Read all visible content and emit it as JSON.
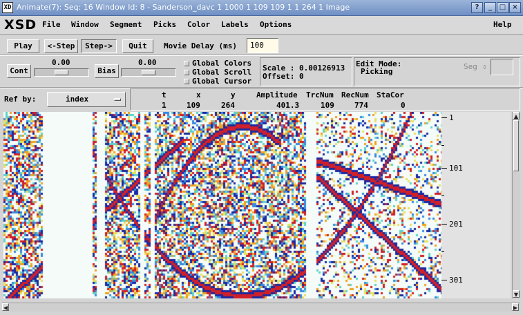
{
  "window": {
    "title": "Animate(7): Seq: 16 Window Id: 8 - Sanderson_davc 1 1000 1 109 109 1 1 264 1 Image",
    "icon": "xsd-icon"
  },
  "menubar": {
    "logo": "XSD",
    "items": [
      "File",
      "Window",
      "Segment",
      "Picks",
      "Color",
      "Labels",
      "Options"
    ],
    "help": "Help"
  },
  "toolbar": {
    "play": "Play",
    "step_back": "<-Step",
    "step_forward": "Step->",
    "quit": "Quit",
    "movie_delay_label": "Movie Delay (ms)",
    "movie_delay_value": "100"
  },
  "controls": {
    "cont_label": "Cont",
    "cont_value": "0.00",
    "cont_level": 0.5,
    "bias_label": "Bias",
    "bias_value": "0.00",
    "bias_level": 0.5,
    "global_colors": "Global Colors",
    "global_scroll": "Global Scroll",
    "global_cursor": "Global Cursor",
    "scale_line": "Scale : 0.00126913",
    "offset_line": "Offset: 0",
    "edit_mode_label": "Edit Mode:",
    "edit_mode_value": "Picking",
    "seg_label": "Seg",
    "seg_value": ""
  },
  "readout": {
    "ref_by_label": "Ref by:",
    "ref_by_value": "index",
    "headers": [
      "t",
      "x",
      "y",
      "Amplitude",
      "TrcNum",
      "RecNum",
      "StaCor"
    ],
    "values": [
      "1",
      "109",
      "264",
      "401.3",
      "109",
      "774",
      "0"
    ]
  },
  "axis": {
    "labels": [
      "1",
      "101",
      "201",
      "301"
    ]
  },
  "colors": {
    "background": "#d4d4d4",
    "plot_background": "#f4fbf8",
    "positive_peak": "#d0202a",
    "negative_peak": "#1c2aa0"
  }
}
